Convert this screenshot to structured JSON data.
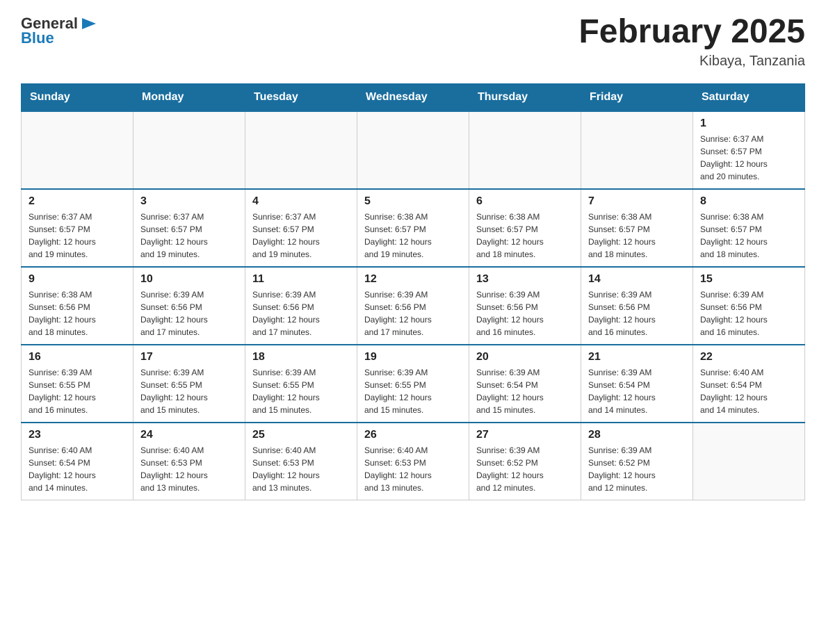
{
  "logo": {
    "text_general": "General",
    "text_blue": "Blue"
  },
  "title": "February 2025",
  "location": "Kibaya, Tanzania",
  "weekdays": [
    "Sunday",
    "Monday",
    "Tuesday",
    "Wednesday",
    "Thursday",
    "Friday",
    "Saturday"
  ],
  "weeks": [
    [
      {
        "day": "",
        "info": ""
      },
      {
        "day": "",
        "info": ""
      },
      {
        "day": "",
        "info": ""
      },
      {
        "day": "",
        "info": ""
      },
      {
        "day": "",
        "info": ""
      },
      {
        "day": "",
        "info": ""
      },
      {
        "day": "1",
        "info": "Sunrise: 6:37 AM\nSunset: 6:57 PM\nDaylight: 12 hours\nand 20 minutes."
      }
    ],
    [
      {
        "day": "2",
        "info": "Sunrise: 6:37 AM\nSunset: 6:57 PM\nDaylight: 12 hours\nand 19 minutes."
      },
      {
        "day": "3",
        "info": "Sunrise: 6:37 AM\nSunset: 6:57 PM\nDaylight: 12 hours\nand 19 minutes."
      },
      {
        "day": "4",
        "info": "Sunrise: 6:37 AM\nSunset: 6:57 PM\nDaylight: 12 hours\nand 19 minutes."
      },
      {
        "day": "5",
        "info": "Sunrise: 6:38 AM\nSunset: 6:57 PM\nDaylight: 12 hours\nand 19 minutes."
      },
      {
        "day": "6",
        "info": "Sunrise: 6:38 AM\nSunset: 6:57 PM\nDaylight: 12 hours\nand 18 minutes."
      },
      {
        "day": "7",
        "info": "Sunrise: 6:38 AM\nSunset: 6:57 PM\nDaylight: 12 hours\nand 18 minutes."
      },
      {
        "day": "8",
        "info": "Sunrise: 6:38 AM\nSunset: 6:57 PM\nDaylight: 12 hours\nand 18 minutes."
      }
    ],
    [
      {
        "day": "9",
        "info": "Sunrise: 6:38 AM\nSunset: 6:56 PM\nDaylight: 12 hours\nand 18 minutes."
      },
      {
        "day": "10",
        "info": "Sunrise: 6:39 AM\nSunset: 6:56 PM\nDaylight: 12 hours\nand 17 minutes."
      },
      {
        "day": "11",
        "info": "Sunrise: 6:39 AM\nSunset: 6:56 PM\nDaylight: 12 hours\nand 17 minutes."
      },
      {
        "day": "12",
        "info": "Sunrise: 6:39 AM\nSunset: 6:56 PM\nDaylight: 12 hours\nand 17 minutes."
      },
      {
        "day": "13",
        "info": "Sunrise: 6:39 AM\nSunset: 6:56 PM\nDaylight: 12 hours\nand 16 minutes."
      },
      {
        "day": "14",
        "info": "Sunrise: 6:39 AM\nSunset: 6:56 PM\nDaylight: 12 hours\nand 16 minutes."
      },
      {
        "day": "15",
        "info": "Sunrise: 6:39 AM\nSunset: 6:56 PM\nDaylight: 12 hours\nand 16 minutes."
      }
    ],
    [
      {
        "day": "16",
        "info": "Sunrise: 6:39 AM\nSunset: 6:55 PM\nDaylight: 12 hours\nand 16 minutes."
      },
      {
        "day": "17",
        "info": "Sunrise: 6:39 AM\nSunset: 6:55 PM\nDaylight: 12 hours\nand 15 minutes."
      },
      {
        "day": "18",
        "info": "Sunrise: 6:39 AM\nSunset: 6:55 PM\nDaylight: 12 hours\nand 15 minutes."
      },
      {
        "day": "19",
        "info": "Sunrise: 6:39 AM\nSunset: 6:55 PM\nDaylight: 12 hours\nand 15 minutes."
      },
      {
        "day": "20",
        "info": "Sunrise: 6:39 AM\nSunset: 6:54 PM\nDaylight: 12 hours\nand 15 minutes."
      },
      {
        "day": "21",
        "info": "Sunrise: 6:39 AM\nSunset: 6:54 PM\nDaylight: 12 hours\nand 14 minutes."
      },
      {
        "day": "22",
        "info": "Sunrise: 6:40 AM\nSunset: 6:54 PM\nDaylight: 12 hours\nand 14 minutes."
      }
    ],
    [
      {
        "day": "23",
        "info": "Sunrise: 6:40 AM\nSunset: 6:54 PM\nDaylight: 12 hours\nand 14 minutes."
      },
      {
        "day": "24",
        "info": "Sunrise: 6:40 AM\nSunset: 6:53 PM\nDaylight: 12 hours\nand 13 minutes."
      },
      {
        "day": "25",
        "info": "Sunrise: 6:40 AM\nSunset: 6:53 PM\nDaylight: 12 hours\nand 13 minutes."
      },
      {
        "day": "26",
        "info": "Sunrise: 6:40 AM\nSunset: 6:53 PM\nDaylight: 12 hours\nand 13 minutes."
      },
      {
        "day": "27",
        "info": "Sunrise: 6:39 AM\nSunset: 6:52 PM\nDaylight: 12 hours\nand 12 minutes."
      },
      {
        "day": "28",
        "info": "Sunrise: 6:39 AM\nSunset: 6:52 PM\nDaylight: 12 hours\nand 12 minutes."
      },
      {
        "day": "",
        "info": ""
      }
    ]
  ]
}
